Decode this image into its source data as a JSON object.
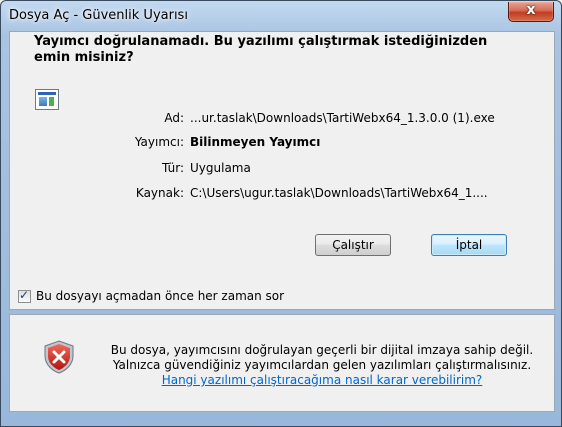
{
  "window": {
    "title": "Dosya Aç - Güvenlik Uyarısı",
    "close_label": "x"
  },
  "dialog": {
    "headline": "Yayımcı doğrulanamadı. Bu yazılımı çalıştırmak istediğinizden emin misiniz?",
    "fields": [
      {
        "label": "Ad:",
        "value": "...ur.taslak\\Downloads\\TartiWebx64_1.3.0.0 (1).exe"
      },
      {
        "label": "Yayımcı:",
        "value": "Bilinmeyen Yayımcı"
      },
      {
        "label": "Tür:",
        "value": "Uygulama"
      },
      {
        "label": "Kaynak:",
        "value": "C:\\Users\\ugur.taslak\\Downloads\\TartiWebx64_1...."
      }
    ],
    "run_button": "Çalıştır",
    "cancel_button": "İptal",
    "always_ask_checkbox": {
      "label": "Bu dosyayı açmadan önce her zaman sor",
      "checked": true
    }
  },
  "warning": {
    "line1": "Bu dosya, yayımcısını doğrulayan geçerli bir dijital imzaya sahip değil.",
    "line2": "Yalnızca güvendiğiniz yayımcılardan gelen yazılımları çalıştırmalısınız.",
    "link": "Hangi yazılımı çalıştıracağıma nasıl karar verebilirim?"
  },
  "icons": {
    "file": "application-file-icon",
    "shield": "security-shield-icon",
    "close": "close-icon"
  },
  "colors": {
    "link": "#0066cc",
    "shield_red": "#d4231b"
  }
}
